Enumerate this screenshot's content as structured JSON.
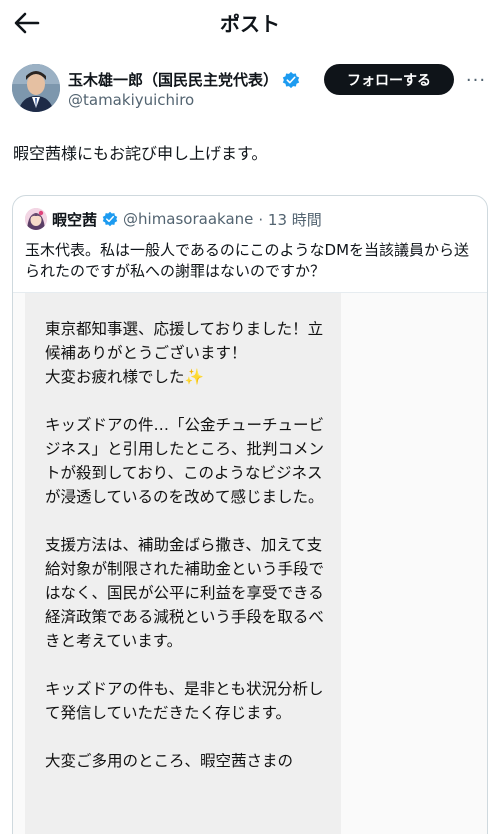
{
  "header": {
    "title": "ポスト"
  },
  "author": {
    "name": "玉木雄一郎（国民民主党代表）",
    "handle": "@tamakiyuichiro",
    "follow_label": "フォローする",
    "more_label": "···"
  },
  "tweet": {
    "text": "暇空茜様にもお詫び申し上げます。"
  },
  "quote": {
    "name": "暇空茜",
    "handle": "@himasoraakane",
    "time": "· 13 時間",
    "text": "玉木代表。私は一般人であるのにこのようなDMを当該議員から送られたのですが私への謝罪はないのですか？"
  },
  "dm": {
    "paragraphs": [
      "東京都知事選、応援しておりました！立候補ありがとうございます！\n大変お疲れ様でした✨",
      "キッズドアの件…「公金チューチュービジネス」と引用したところ、批判コメントが殺到しており、このようなビジネスが浸透しているのを改めて感じました。",
      "支援方法は、補助金ばら撒き、加えて支給対象が制限された補助金という手段ではなく、国民が公平に利益を享受できる経済政策である減税という手段を取るべきと考えています。",
      "キッズドアの件も、是非とも状況分析して発信していただきたく存じます。",
      "大変ご多用のところ、暇空茜さまの"
    ]
  },
  "colors": {
    "accent": "#1d9bf0",
    "text": "#0f1419",
    "muted": "#536471",
    "follow_bg": "#0f1419"
  },
  "icons": {
    "back": "arrow-left-icon",
    "verified": "verified-badge-icon",
    "more": "more-icon"
  }
}
